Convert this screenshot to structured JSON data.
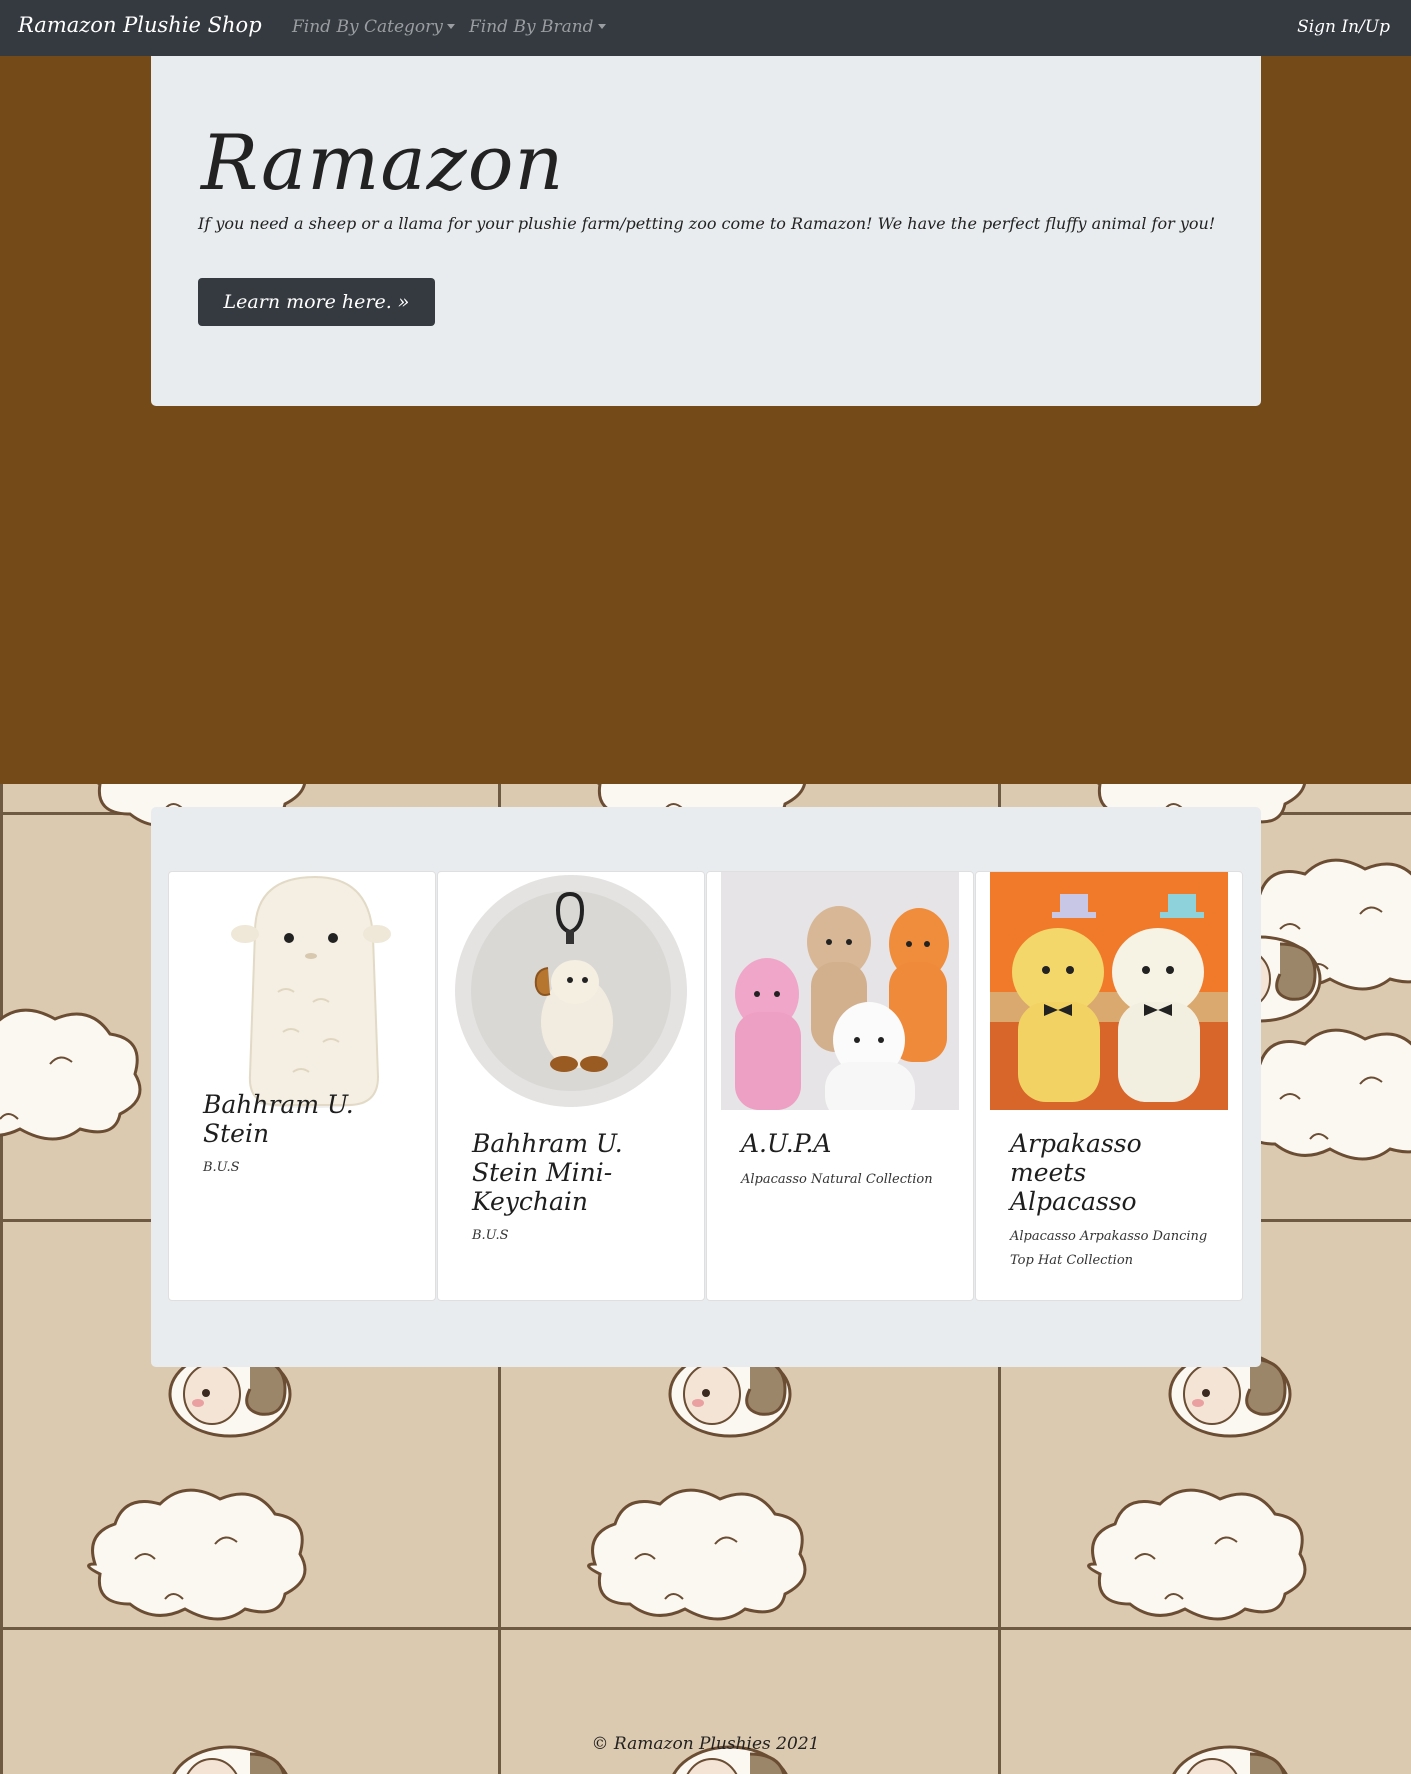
{
  "navbar": {
    "brand": "Ramazon Plushie Shop",
    "category_label": "Find By Category",
    "brand_label": "Find By Brand",
    "signin_label": "Sign In/Up"
  },
  "jumbotron": {
    "title": "Ramazon",
    "description": "If you need a sheep or a llama for your plushie farm/petting zoo come to Ramazon! We have the perfect fluffy animal for you!",
    "button_label": "Learn more here. »"
  },
  "products": [
    {
      "title": "Bahhram U. Stein",
      "brand": "B.U.S"
    },
    {
      "title": "Bahhram U. Stein Mini-Keychain",
      "brand": "B.U.S"
    },
    {
      "title": "A.U.P.A",
      "brand": "Alpacasso Natural Collection"
    },
    {
      "title": "Arpakasso meets Alpacasso",
      "brand": "Alpacasso Arpakasso Dancing Top Hat Collection"
    }
  ],
  "footer": {
    "text": "© Ramazon Plushies 2021"
  },
  "colors": {
    "navbar": "#343a40",
    "background_brown": "#734a18",
    "panel": "#e9ecef",
    "tile": "#dccab0"
  }
}
